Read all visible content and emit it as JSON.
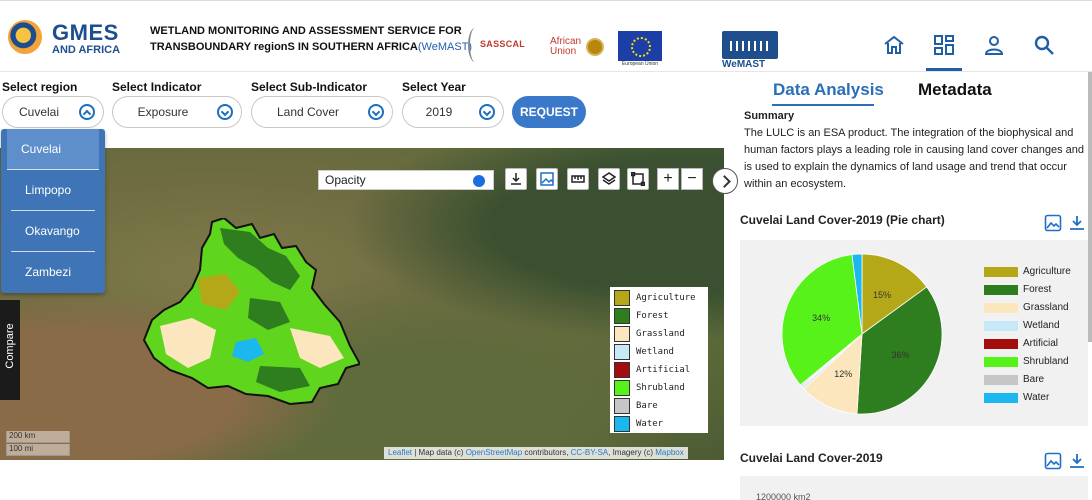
{
  "header": {
    "logo_main": "GMES",
    "logo_sub": "AND AFRICA",
    "title_line1": "WETLAND MONITORING AND ASSESSMENT SERVICE FOR",
    "title_line2": "TRANSBOUNDARY regionS IN SOUTHERN AFRICA",
    "title_acronym": "(WeMAST)",
    "partner_sasscal": "SASSCAL",
    "partner_au_line1": "African",
    "partner_au_line2": "Union",
    "partner_eu": "European Union",
    "wemast_logo": "WeMAST",
    "nav_icons": [
      "home-icon",
      "dashboard-icon",
      "user-icon",
      "search-icon"
    ]
  },
  "selectors": {
    "region_label": "Select region",
    "region_value": "Cuvelai",
    "indicator_label": "Select Indicator",
    "indicator_value": "Exposure",
    "subindicator_label": "Select Sub-Indicator",
    "subindicator_value": "Land Cover",
    "year_label": "Select Year",
    "year_value": "2019",
    "request_label": "REQUEST"
  },
  "region_options": [
    "Cuvelai",
    "Limpopo",
    "Okavango",
    "Zambezi"
  ],
  "map": {
    "opacity_label": "Opacity",
    "opacity_value": 1.0,
    "compare_label": "Compare",
    "scale_km": "200 km",
    "scale_mi": "100 mi",
    "attribution_prefix": "Leaflet",
    "attribution_mid": " | Map data (c) ",
    "attribution_osm": "OpenStreetMap",
    "attribution_contrib": " contributors, ",
    "attribution_license": "CC-BY-SA",
    "attribution_imagery": ", Imagery (c) ",
    "attribution_mapbox": "Mapbox",
    "legend": [
      {
        "label": "Agriculture",
        "color": "#b5a818"
      },
      {
        "label": "Forest",
        "color": "#2e7d1f"
      },
      {
        "label": "Grassland",
        "color": "#fbe6bd"
      },
      {
        "label": "Wetland",
        "color": "#c7e9f7"
      },
      {
        "label": "Artificial",
        "color": "#a30d0d"
      },
      {
        "label": "Shrubland",
        "color": "#57f21a"
      },
      {
        "label": "Bare",
        "color": "#c6c6c6"
      },
      {
        "label": "Water",
        "color": "#1ab8ee"
      }
    ]
  },
  "panel": {
    "tab_analysis": "Data Analysis",
    "tab_metadata": "Metadata",
    "summary_heading": "Summary",
    "summary_text": "The LULC is an ESA product. The integration of the biophysical and human factors plays a leading role in causing land cover changes and is used to explain the dynamics of land usage and trend that occur within an ecosystem.",
    "pie_title": "Cuvelai Land Cover-2019 (Pie chart)",
    "bar_title": "Cuvelai Land Cover-2019",
    "bar_top_tick": "1200000 km2"
  },
  "chart_data": {
    "type": "pie",
    "title": "Cuvelai Land Cover-2019 (Pie chart)",
    "legend_position": "right",
    "slices": [
      {
        "label": "Agriculture",
        "value": 15,
        "color": "#b5a818",
        "shown_label": "15%"
      },
      {
        "label": "Forest",
        "value": 36,
        "color": "#2e7d1f",
        "shown_label": "36%"
      },
      {
        "label": "Grassland",
        "value": 12,
        "color": "#fbe6bd",
        "shown_label": "12%"
      },
      {
        "label": "Wetland",
        "value": 0.5,
        "color": "#c7e9f7",
        "shown_label": ""
      },
      {
        "label": "Artificial",
        "value": 0.2,
        "color": "#a30d0d",
        "shown_label": ""
      },
      {
        "label": "Shrubland",
        "value": 34,
        "color": "#57f21a",
        "shown_label": "34%"
      },
      {
        "label": "Bare",
        "value": 0.3,
        "color": "#c6c6c6",
        "shown_label": ""
      },
      {
        "label": "Water",
        "value": 2,
        "color": "#1ab8ee",
        "shown_label": ""
      }
    ]
  }
}
